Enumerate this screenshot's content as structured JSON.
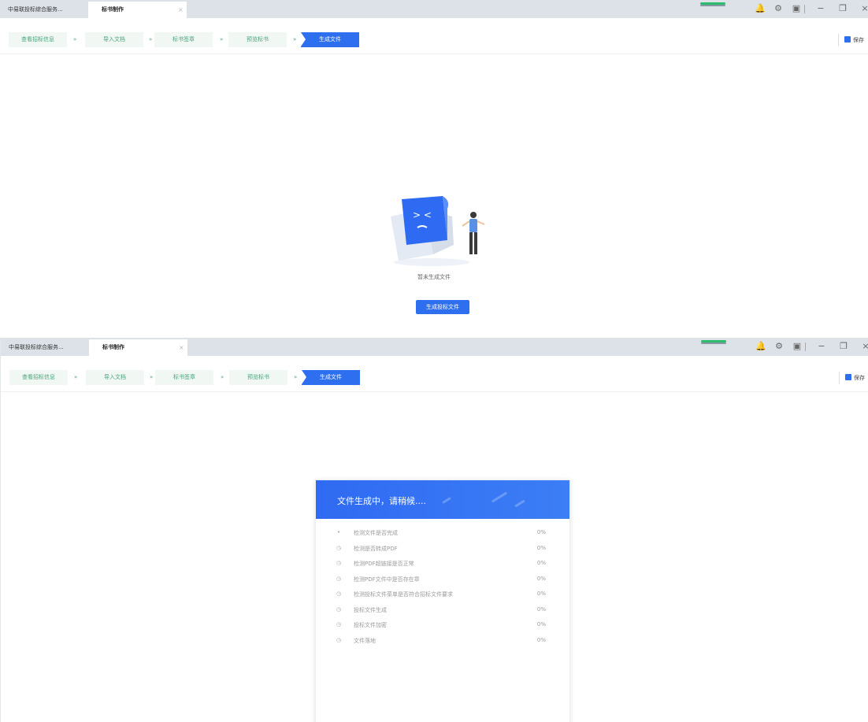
{
  "tabs": [
    {
      "label": "中易联投标综合服务..."
    },
    {
      "label": "标书制作"
    }
  ],
  "tab_close": "×",
  "window_icons": {
    "bell": "🔔",
    "settings": "⚙",
    "screenshot": "▣",
    "minimize": "−",
    "maximize": "❐",
    "close": "×"
  },
  "steps": [
    {
      "label": "查看招标信息"
    },
    {
      "label": "导入文档"
    },
    {
      "label": "标书签章"
    },
    {
      "label": "预览标书"
    },
    {
      "label": "生成文件"
    }
  ],
  "step_arrow": "»",
  "save_label": "保存",
  "empty_state": {
    "text": "暂未生成文件",
    "button": "生成投标文件"
  },
  "dialog": {
    "title": "文件生成中，请稍候....",
    "items": [
      {
        "icon": "•",
        "label": "检测文件是否完成",
        "percent": "0%"
      },
      {
        "icon": "◷",
        "label": "检测是否转成PDF",
        "percent": "0%"
      },
      {
        "icon": "◷",
        "label": "检测PDF超链接是否正常",
        "percent": "0%"
      },
      {
        "icon": "◷",
        "label": "检测PDF文件中是否存在章",
        "percent": "0%"
      },
      {
        "icon": "◷",
        "label": "检测投标文件菜单是否符合招标文件要求",
        "percent": "0%"
      },
      {
        "icon": "◷",
        "label": "投标文件生成",
        "percent": "0%"
      },
      {
        "icon": "◷",
        "label": "投标文件加密",
        "percent": "0%"
      },
      {
        "icon": "◷",
        "label": "文件落地",
        "percent": "0%"
      }
    ]
  },
  "colors": {
    "accent": "#2e6ff0",
    "step_text": "#47a37a",
    "progress_green": "#2bbd6b"
  }
}
